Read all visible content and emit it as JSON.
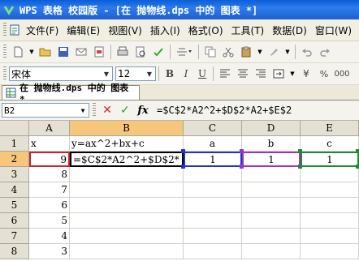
{
  "window": {
    "title": "WPS 表格 校园版 - [在 抛物线.dps 中的 图表 *]"
  },
  "menu": {
    "items": [
      "文件(F)",
      "编辑(E)",
      "视图(V)",
      "插入(I)",
      "格式(O)",
      "工具(T)",
      "数据(D)",
      "窗口(W)"
    ]
  },
  "format_toolbar": {
    "font_name": "宋体",
    "font_size": "12",
    "bold": "B",
    "italic": "I",
    "underline": "U"
  },
  "doc_tab": {
    "label": "在 抛物线.dps 中的 图表 *"
  },
  "formula_bar": {
    "name_box": "B2",
    "cancel_symbol": "✕",
    "enter_symbol": "✓",
    "fx_symbol": "fx",
    "formula": "=$C$2*A2^2+$D$2*A2+$E$2"
  },
  "sheet": {
    "columns": [
      "A",
      "B",
      "C",
      "D",
      "E"
    ],
    "rows": [
      "1",
      "2",
      "3",
      "4",
      "5",
      "6",
      "7",
      "8"
    ],
    "cells": {
      "A1": "x",
      "B1": "y=ax^2+bx+c",
      "C1": "a",
      "D1": "b",
      "E1": "c",
      "A2": "9",
      "B2": "=$C$2*A2^2+$D$2*",
      "C2": "1",
      "D2": "1",
      "E2": "1",
      "A3": "8",
      "A4": "7",
      "A5": "6",
      "A6": "5",
      "A7": "4",
      "A8": "3"
    },
    "active_cell": "B2",
    "highlight_colors": {
      "A2": "#C0282D",
      "C2": "#2233CC",
      "D2": "#9933CC",
      "E2": "#228833",
      "selection_header": "#F6C67A"
    }
  }
}
